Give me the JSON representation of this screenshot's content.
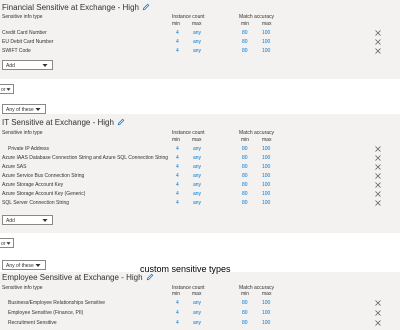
{
  "columns": {
    "info_type": "Sensitive info type",
    "instance_count": "Instance count",
    "match_accuracy": "Match accuracy",
    "min": "min",
    "max": "max"
  },
  "section1": {
    "title": "Financial Sensitive at Exchange - High",
    "rows": [
      {
        "name": "Credit Card Number",
        "inst_min": "4",
        "inst_max": "any",
        "acc_min": "80",
        "acc_max": "100"
      },
      {
        "name": "EU Debit Card Number",
        "inst_min": "4",
        "inst_max": "any",
        "acc_min": "80",
        "acc_max": "100"
      },
      {
        "name": "SWIFT Code",
        "inst_min": "4",
        "inst_max": "any",
        "acc_min": "80",
        "acc_max": "100"
      }
    ],
    "add_label": "Add"
  },
  "between1": {
    "or_label": "or",
    "any_label": "Any of these"
  },
  "section2": {
    "title": "IT Sensitive at Exchange - High",
    "rows": [
      {
        "name": "Private IP Address",
        "inst_min": "4",
        "inst_max": "any",
        "acc_min": "80",
        "acc_max": "100"
      },
      {
        "name": "Azure IAAS Database Connection String and Azure SQL Connection String",
        "inst_min": "4",
        "inst_max": "any",
        "acc_min": "80",
        "acc_max": "100"
      },
      {
        "name": "Azure SAS",
        "inst_min": "4",
        "inst_max": "any",
        "acc_min": "80",
        "acc_max": "100"
      },
      {
        "name": "Azure Service Bus Connection String",
        "inst_min": "4",
        "inst_max": "any",
        "acc_min": "80",
        "acc_max": "100"
      },
      {
        "name": "Azure Storage Account Key",
        "inst_min": "4",
        "inst_max": "any",
        "acc_min": "80",
        "acc_max": "100"
      },
      {
        "name": "Azure Storage Account Key (Generic)",
        "inst_min": "4",
        "inst_max": "any",
        "acc_min": "80",
        "acc_max": "100"
      },
      {
        "name": "SQL Server Connection String",
        "inst_min": "4",
        "inst_max": "any",
        "acc_min": "80",
        "acc_max": "100"
      }
    ],
    "add_label": "Add"
  },
  "between2": {
    "or_label": "or",
    "any_label": "Any of these"
  },
  "section3": {
    "title": "Employee Sensitive at Exchange - High",
    "rows": [
      {
        "name": "Business/Employee Relationships Sensitive",
        "inst_min": "4",
        "inst_max": "any",
        "acc_min": "80",
        "acc_max": "100"
      },
      {
        "name": "Employee Sensitive (Finance, PII)",
        "inst_min": "4",
        "inst_max": "any",
        "acc_min": "80",
        "acc_max": "100"
      },
      {
        "name": "Recruitment Sensitive",
        "inst_min": "4",
        "inst_max": "any",
        "acc_min": "80",
        "acc_max": "100"
      }
    ]
  },
  "annotation": "custom sensitive types",
  "icons": {
    "edit": "pencil-icon",
    "remove": "close-icon",
    "dropdown": "chevron-down-icon"
  },
  "colors": {
    "panel_bg": "#f3f2f1",
    "link_blue": "#0078d4",
    "text": "#323130"
  }
}
